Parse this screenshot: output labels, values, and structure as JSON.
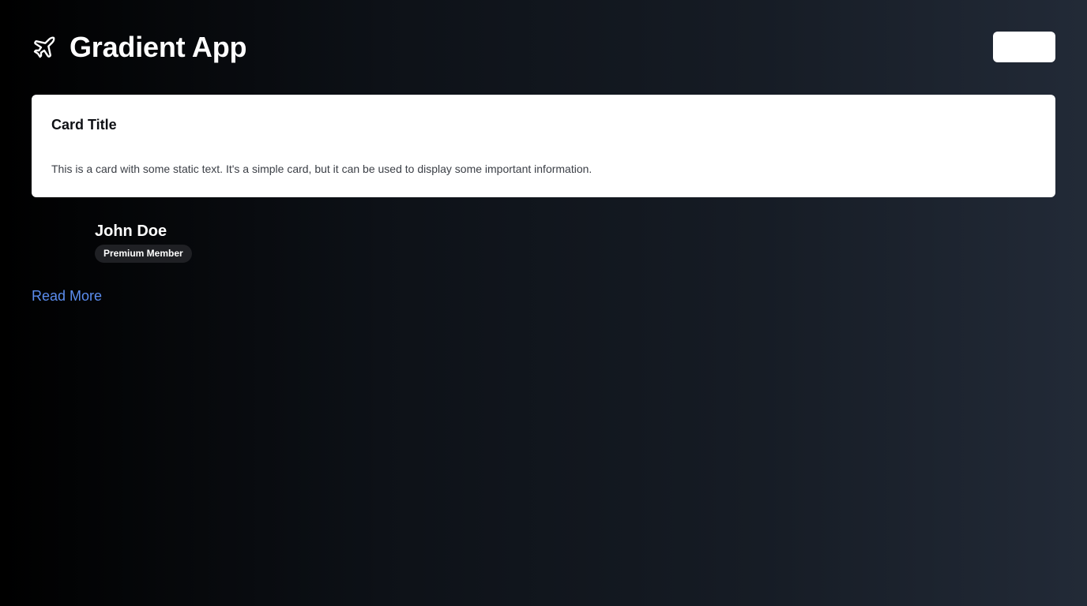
{
  "header": {
    "logo_icon": "airplane-icon",
    "title": "Gradient App",
    "button_label": ""
  },
  "card": {
    "title": "Card Title",
    "text": "This is a card with some static text. It's a simple card, but it can be used to display some important information."
  },
  "profile": {
    "name": "John Doe",
    "badge": "Premium Member"
  },
  "link": {
    "label": "Read More"
  },
  "colors": {
    "link": "#5b8def",
    "card_bg": "#ffffff",
    "badge_bg": "#1f2024",
    "gradient_start": "#000000",
    "gradient_end": "#222a37"
  }
}
